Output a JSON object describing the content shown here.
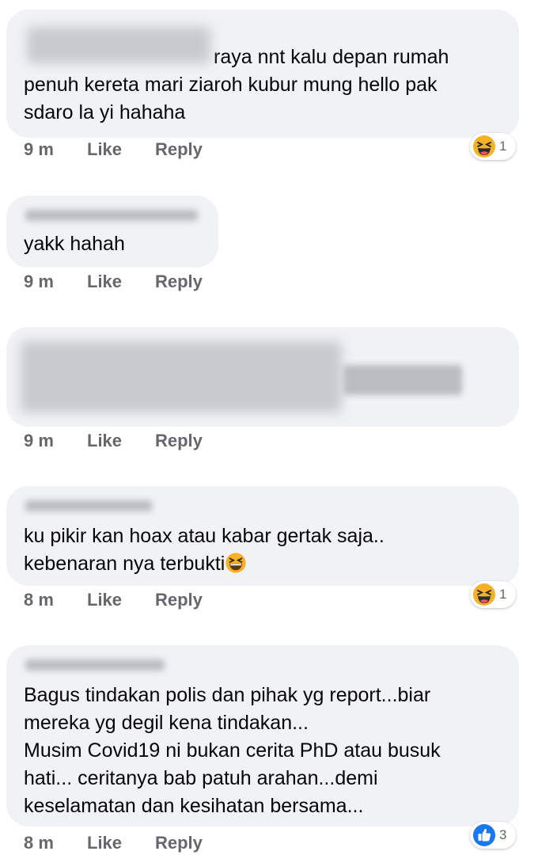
{
  "colors": {
    "bubble_bg": "#f0f2f5",
    "text": "#050505",
    "meta": "#65676b",
    "haha_yellow": "#f7b125",
    "like_blue": "#1877f2"
  },
  "comments": [
    {
      "text": "raya nnt kalu depan rumah\npenuh kereta mari ziaroh kubur mung hello pak\nsdaro la yi hahaha",
      "time": "9 m",
      "like": "Like",
      "reply": "Reply",
      "reaction": {
        "icon": "haha-icon",
        "count": "1"
      }
    },
    {
      "text": "yakk hahah",
      "time": "9 m",
      "like": "Like",
      "reply": "Reply"
    },
    {
      "text": "",
      "time": "9 m",
      "like": "Like",
      "reply": "Reply"
    },
    {
      "text": "ku pikir kan hoax atau kabar gertak saja..\nkebenaran nya terbukti",
      "time": "8 m",
      "like": "Like",
      "reply": "Reply",
      "inline_emoji": "laughing-emoji-icon",
      "reaction": {
        "icon": "haha-icon",
        "count": "1"
      }
    },
    {
      "text": "Bagus tindakan polis dan pihak yg report...biar\nmereka yg degil kena tindakan...\nMusim Covid19 ni bukan cerita PhD atau busuk\nhati... ceritanya bab patuh arahan...demi\nkeselamatan dan kesihatan bersama...",
      "time": "8 m",
      "like": "Like",
      "reply": "Reply",
      "reaction": {
        "icon": "like-icon",
        "count": "3"
      }
    }
  ]
}
